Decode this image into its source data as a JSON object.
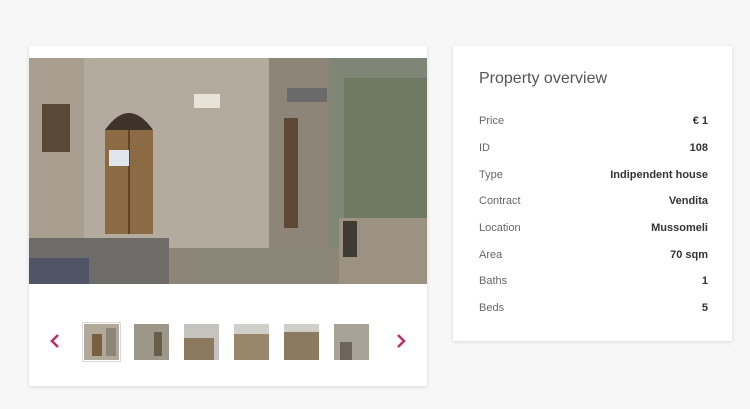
{
  "overview": {
    "title": "Property overview",
    "rows": [
      {
        "label": "Price",
        "value": "€ 1"
      },
      {
        "label": "ID",
        "value": "108"
      },
      {
        "label": "Type",
        "value": "Indipendent house"
      },
      {
        "label": "Contract",
        "value": "Vendita"
      },
      {
        "label": "Location",
        "value": "Mussomeli"
      },
      {
        "label": "Area",
        "value": "70 sqm"
      },
      {
        "label": "Baths",
        "value": "1"
      },
      {
        "label": "Beds",
        "value": "5"
      }
    ]
  },
  "gallery": {
    "thumbnail_count": 6,
    "active_thumbnail": 1,
    "arrow_color": "#c0306a"
  }
}
